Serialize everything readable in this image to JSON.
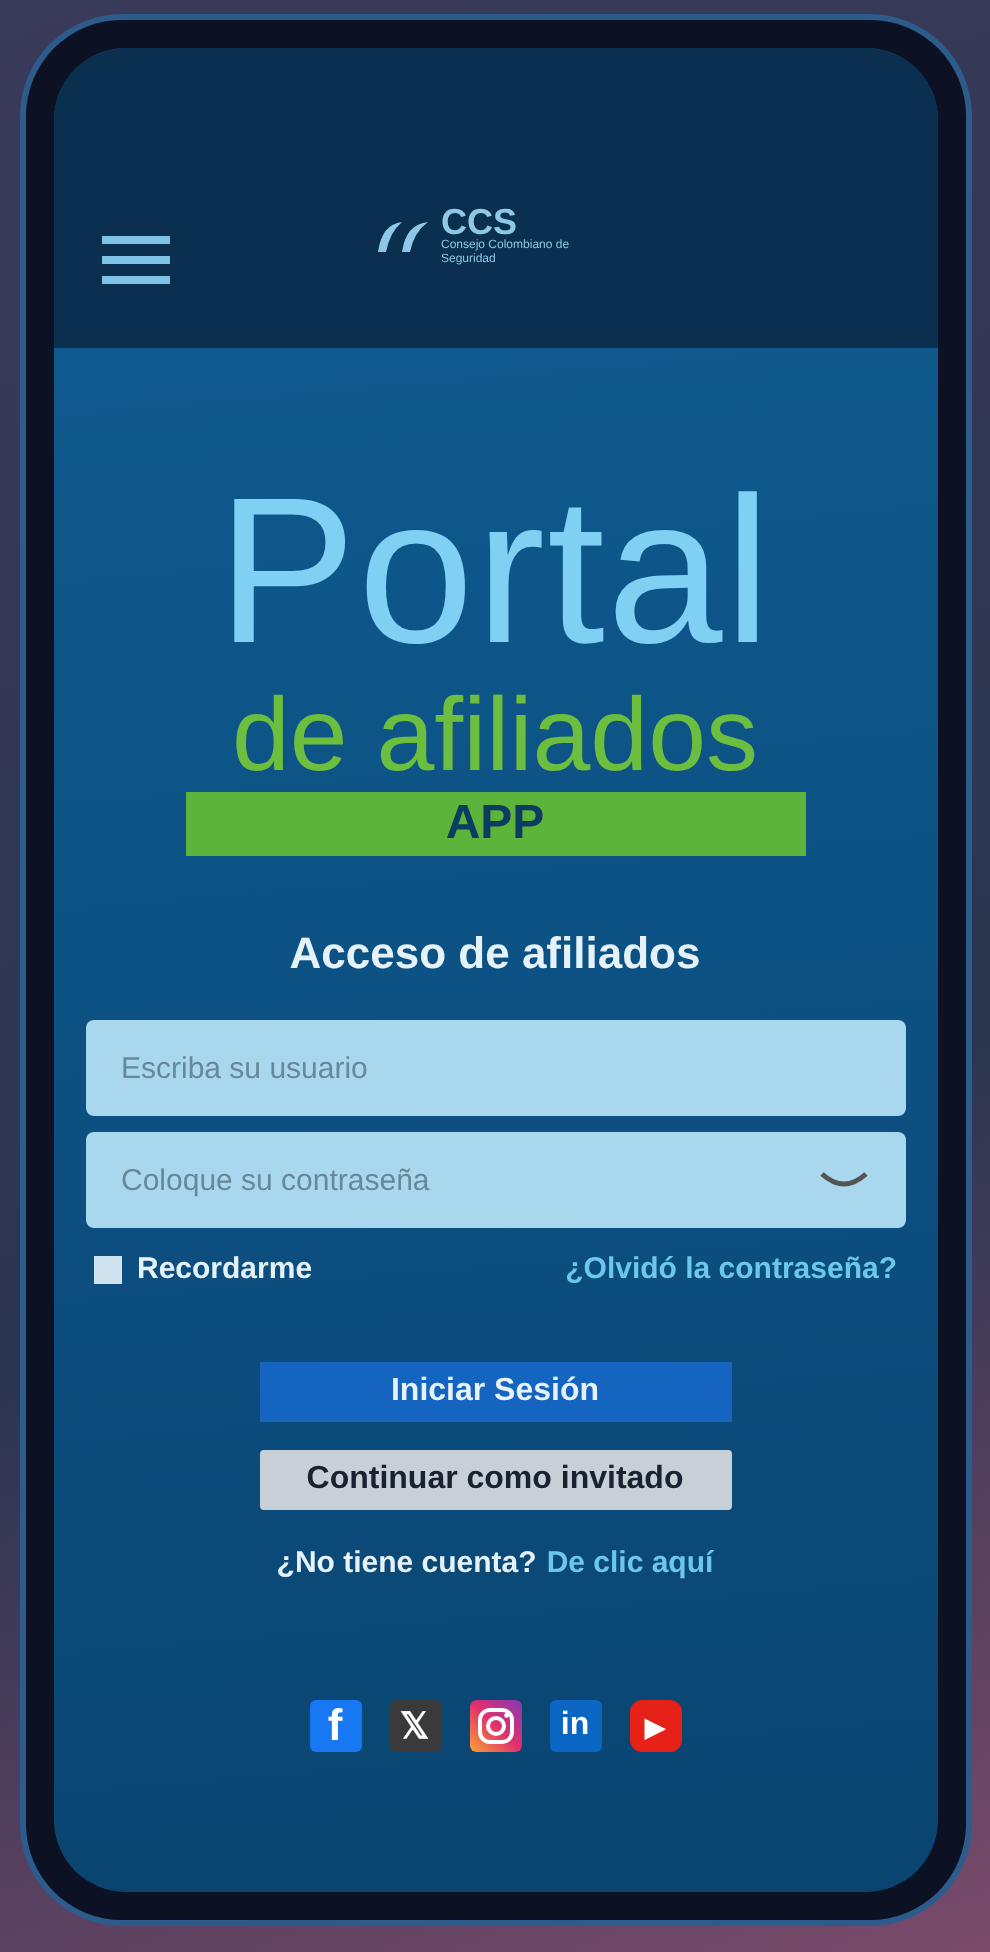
{
  "header": {
    "logo": {
      "name": "CCS",
      "subtitle": "Consejo Colombiano de Seguridad"
    }
  },
  "hero": {
    "title": "Portal",
    "subtitle": "de afiliados",
    "badge": "APP"
  },
  "login": {
    "heading": "Acceso de afiliados",
    "username": {
      "placeholder": "Escriba su usuario"
    },
    "password": {
      "placeholder": "Coloque su contraseña"
    },
    "remember": {
      "label": "Recordarme",
      "checked": false
    },
    "forgot": "¿Olvidó la contraseña?",
    "primary_button": "Iniciar Sesión",
    "guest_button": "Continuar como invitado",
    "signup": {
      "text": "¿No tiene cuenta?",
      "link": "De clic aquí"
    }
  },
  "social": [
    {
      "kind": "facebook",
      "glyph": "f"
    },
    {
      "kind": "x",
      "glyph": "𝕏"
    },
    {
      "kind": "instagram"
    },
    {
      "kind": "linkedin",
      "glyph": "in"
    },
    {
      "kind": "youtube",
      "glyph": "▶"
    }
  ]
}
